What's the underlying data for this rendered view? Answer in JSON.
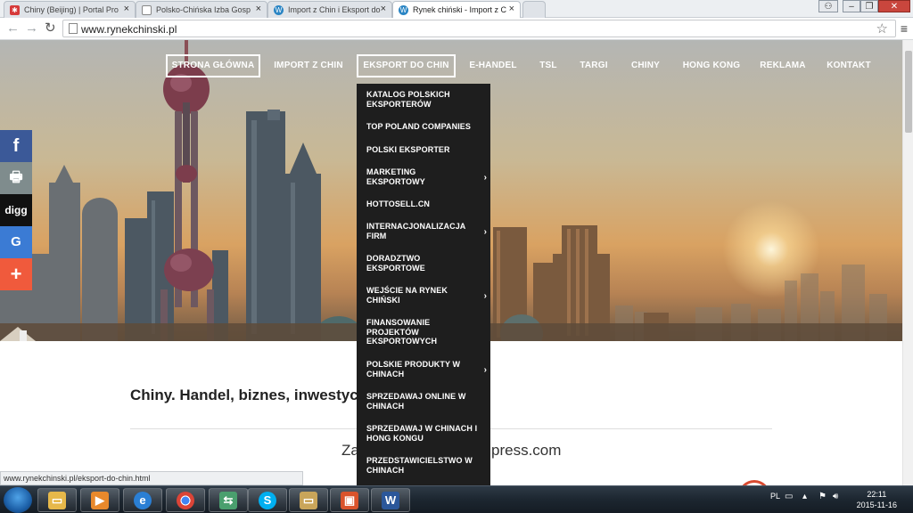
{
  "browser": {
    "tabs": [
      {
        "label": "Chiny (Beijing) | Portal Pro",
        "active": false,
        "icon": "portal-favicon"
      },
      {
        "label": "Polsko-Chińska Izba Gosp",
        "active": false,
        "icon": "page-icon"
      },
      {
        "label": "Import z Chin i Eksport do",
        "active": false,
        "icon": "wordpress-favicon"
      },
      {
        "label": "Rynek chiński - Import z C",
        "active": true,
        "icon": "wordpress-favicon"
      }
    ],
    "url": "www.rynekchinski.pl",
    "status_url": "www.rynekchinski.pl/eksport-do-chin.html"
  },
  "site": {
    "nav": [
      {
        "label": "STRONA GŁÓWNA",
        "boxed": true
      },
      {
        "label": "IMPORT Z CHIN",
        "boxed": false
      },
      {
        "label": "EKSPORT DO CHIN",
        "boxed": true
      },
      {
        "label": "E-HANDEL",
        "boxed": false
      },
      {
        "label": "TSL",
        "boxed": false
      },
      {
        "label": "TARGI",
        "boxed": false
      },
      {
        "label": "CHINY",
        "boxed": false
      },
      {
        "label": "HONG KONG",
        "boxed": false
      },
      {
        "label": "REKLAMA",
        "boxed": false
      },
      {
        "label": "KONTAKT",
        "boxed": false
      }
    ],
    "dropdown": [
      {
        "label": "KATALOG POLSKICH EKSPORTERÓW",
        "submenu": false
      },
      {
        "label": "TOP POLAND COMPANIES",
        "submenu": false
      },
      {
        "label": "POLSKI EKSPORTER",
        "submenu": false
      },
      {
        "label": "MARKETING EKSPORTOWY",
        "submenu": true
      },
      {
        "label": "HOTTOSELL.CN",
        "submenu": false
      },
      {
        "label": "INTERNACJONALIZACJA FIRM",
        "submenu": true
      },
      {
        "label": "DORADZTWO EKSPORTOWE",
        "submenu": false
      },
      {
        "label": "WEJŚCIE NA RYNEK CHIŃSKI",
        "submenu": true
      },
      {
        "label": "FINANSOWANIE PROJEKTÓW EKSPORTOWYCH",
        "submenu": false
      },
      {
        "label": "POLSKIE PRODUKTY W CHINACH",
        "submenu": true
      },
      {
        "label": "SPRZEDAWAJ ONLINE W CHINACH",
        "submenu": false
      },
      {
        "label": "SPRZEDAWAJ W CHINACH I HONG KONGU",
        "submenu": false
      },
      {
        "label": "PRZEDSTAWICIELSTWO W CHINACH",
        "submenu": false
      }
    ],
    "social": [
      {
        "name": "facebook",
        "glyph": "f",
        "color": "#3b5998"
      },
      {
        "name": "print",
        "glyph": "🖶",
        "color": "#7f8c8d"
      },
      {
        "name": "digg",
        "glyph": "digg",
        "color": "#111111"
      },
      {
        "name": "google",
        "glyph": "G",
        "color": "#3b7bd4"
      },
      {
        "name": "more",
        "glyph": "+",
        "color": "#f05a3c"
      }
    ],
    "headline": "Chiny. Handel, biznes, inwestycj",
    "sub_left": "Za",
    "sub_right": "press.com"
  },
  "taskbar": {
    "apps": [
      {
        "name": "explorer",
        "glyph": "🗀",
        "color": "#e6b84a"
      },
      {
        "name": "media-player",
        "glyph": "▶",
        "color": "#e8892c"
      },
      {
        "name": "internet-explorer",
        "glyph": "e",
        "color": "#2a7fd4"
      },
      {
        "name": "chrome",
        "glyph": "●",
        "color": "#db4437"
      },
      {
        "name": "network",
        "glyph": "⇆",
        "color": "#4a9f6e"
      },
      {
        "name": "skype",
        "glyph": "S",
        "color": "#00aff0"
      },
      {
        "name": "folder",
        "glyph": "🗀",
        "color": "#c9a55a"
      },
      {
        "name": "presentation",
        "glyph": "▣",
        "color": "#d9532c"
      },
      {
        "name": "word",
        "glyph": "W",
        "color": "#2b579a"
      }
    ],
    "lang": "PL",
    "time": "22:11",
    "date": "2015-11-16"
  },
  "colors": {
    "dropdown_bg": "#1e1e1e",
    "accent": "#f05a3c"
  }
}
